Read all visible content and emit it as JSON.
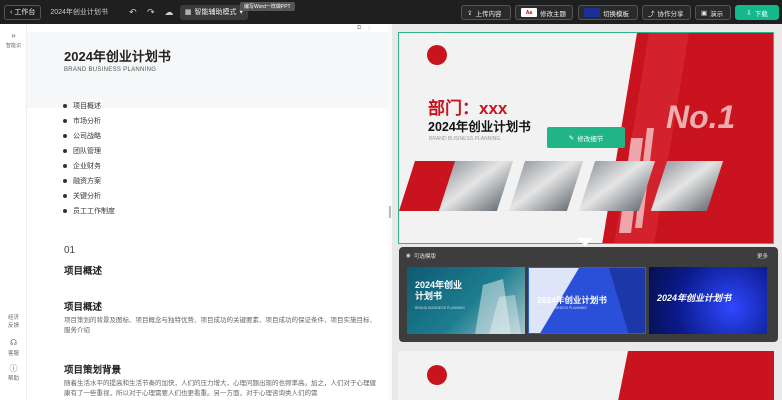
{
  "topbar": {
    "back_label": "工作台",
    "doc_title": "2024年创业计划书",
    "mode_label": "智能辅助模式",
    "tooltip": "编写Word一样做PPT",
    "upload_label": "上传内容",
    "theme_label": "修改主题",
    "theme_thumb_text": "Aa",
    "switch_label": "切换模板",
    "share_label": "协作分享",
    "present_label": "演示",
    "download_label": "下载"
  },
  "leftrail": {
    "collapse_label": "智能识",
    "feedback_label": "经济\n反馈",
    "service_label": "客服",
    "help_label": "帮助"
  },
  "doc": {
    "title": "2024年创业计划书",
    "subtitle": "BRAND BUSINESS PLANNING",
    "toc": [
      "项目概述",
      "市场分析",
      "公司战略",
      "团队管理",
      "企业财务",
      "融资方案",
      "关键分析",
      "员工工作制度"
    ],
    "section_number": "01",
    "section_title": "项目概述",
    "sub1_title": "项目概述",
    "sub1_body": "项目策划的背景及图标、项目概念与独特优势、项目成功的关键要素、项目成功的保证条件、项目实施目标、服务介绍",
    "sub2_title": "项目策划背景",
    "sub2_body": "随着生活水平的提高和生活节奏的加快，人们的压力增大，心理问题出现的也频率高。加之，人们对于心理健康有了一些重视，所以对于心理需要人们也更看重。另一方面，对于心理咨询类人们的需"
  },
  "slide": {
    "dept": "部门：xxx",
    "title": "2024年创业计划书",
    "subtitle": "BRAND BUSINESS PLANNING",
    "badge": "No.1",
    "edit_label": "修改细节"
  },
  "panel": {
    "head": "可选模版",
    "more": "更多",
    "templates": [
      {
        "title": "2024年创业\n计划书",
        "sub": "BRAND BUSINESS PLANNING"
      },
      {
        "title": "2024年创业计划书",
        "sub": "BRAND BUSINESS PLANNING"
      },
      {
        "title": "2024年创业计划书",
        "sub": ""
      }
    ]
  },
  "colors": {
    "accent": "#13b98b",
    "slide_red": "#c9141f",
    "topbar": "#1f1f1f"
  }
}
